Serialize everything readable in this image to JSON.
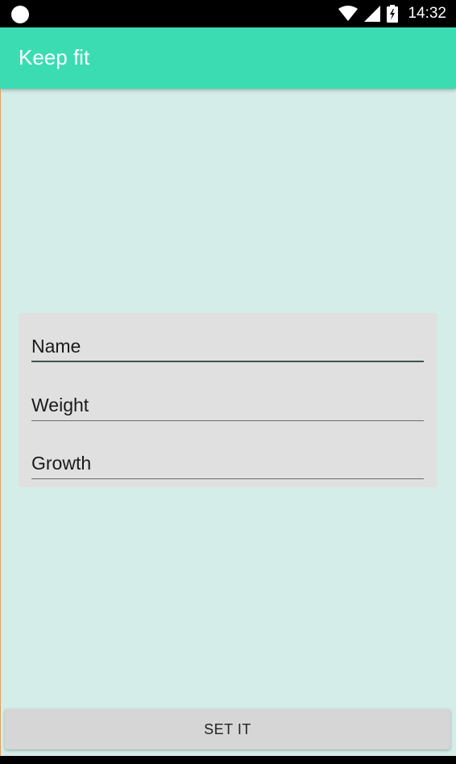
{
  "status_bar": {
    "time": "14:32",
    "icons": [
      "notification-dot-icon",
      "wifi-icon",
      "signal-icon",
      "battery-charging-icon"
    ]
  },
  "app_bar": {
    "title": "Keep fit"
  },
  "form": {
    "name_field": {
      "placeholder": "Name"
    },
    "weight_field": {
      "placeholder": "Weight"
    },
    "growth_field": {
      "placeholder": "Growth"
    }
  },
  "actions": {
    "set_label": "SET IT"
  },
  "colors": {
    "app_bar": "#3bdcb2",
    "background": "#d4ede8",
    "card": "#e0e0e0",
    "button": "#d6d6d6"
  }
}
